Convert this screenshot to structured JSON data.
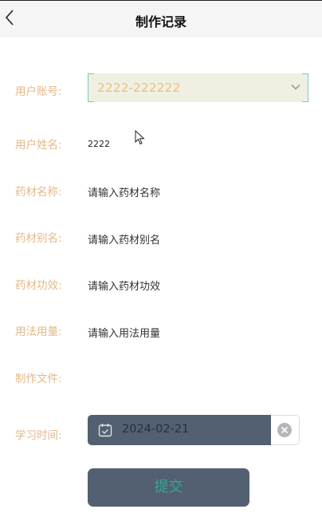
{
  "header": {
    "title": "制作记录"
  },
  "form": {
    "account": {
      "label": "用户账号:",
      "value": "2222-222222"
    },
    "name": {
      "label": "用户姓名:",
      "value": "2222"
    },
    "herb_name": {
      "label": "药材名称:",
      "placeholder": "请输入药材名称"
    },
    "herb_alias": {
      "label": "药材别名:",
      "placeholder": "请输入药材别名"
    },
    "herb_effect": {
      "label": "药材功效:",
      "placeholder": "请输入药材功效"
    },
    "dosage": {
      "label": "用法用量:",
      "placeholder": "请输入用法用量"
    },
    "file": {
      "label": "制作文件:"
    },
    "study_time": {
      "label": "学习时间:",
      "value": "2024-02-21"
    }
  },
  "submit_label": "提交",
  "colors": {
    "label": "#e3b98a",
    "select_bg": "#eff0e1",
    "select_text": "#e9bf86",
    "accent_border": "#7dc7c1",
    "dark_fill": "#526071",
    "submit_text": "#2fa894"
  },
  "icons": [
    "back-arrow-icon",
    "chevron-down-icon",
    "calendar-icon",
    "clear-icon",
    "mouse-cursor-icon"
  ]
}
